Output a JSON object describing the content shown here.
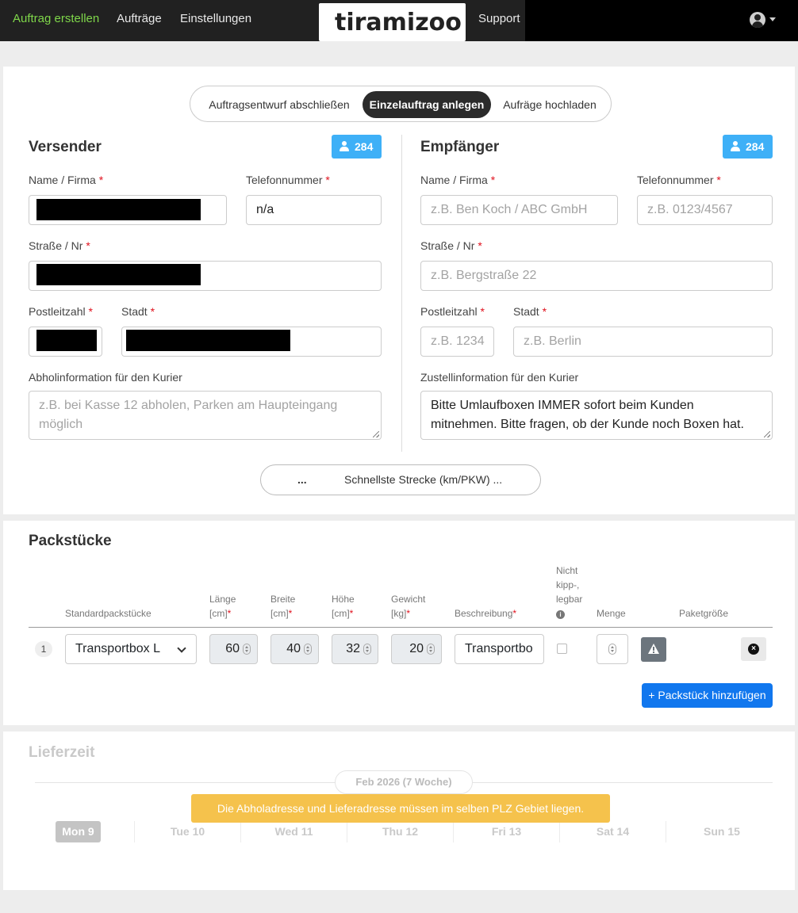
{
  "nav": {
    "create_order": "Auftrag erstellen",
    "orders": "Aufträge",
    "settings": "Einstellungen",
    "logo": "tiramizoo",
    "support": "Support",
    "accent_color": "#7fd74a"
  },
  "tabs": {
    "items": [
      "Auftragsentwurf abschließen",
      "Einzelauftrag anlegen",
      "Aufräge hochladen"
    ],
    "active": "Einzelauftrag anlegen"
  },
  "sender": {
    "title": "Versender",
    "badge_count": "284",
    "name_label": "Name / Firma",
    "phone_label": "Telefonnummer",
    "phone_value": "n/a",
    "street_label": "Straße / Nr",
    "zip_label": "Postleitzahl",
    "city_label": "Stadt",
    "info_label": "Abholinformation für den Kurier",
    "info_placeholder": "z.B. bei Kasse 12 abholen, Parken am Haupteingang möglich"
  },
  "recipient": {
    "title": "Empfänger",
    "badge_count": "284",
    "name_label": "Name / Firma",
    "name_placeholder": "z.B. Ben Koch / ABC GmbH",
    "phone_label": "Telefonnummer",
    "phone_placeholder": "z.B. 0123/4567",
    "street_label": "Straße / Nr",
    "street_placeholder": "z.B. Bergstraße 22",
    "zip_label": "Postleitzahl",
    "zip_placeholder": "z.B. 1234",
    "city_label": "Stadt",
    "city_placeholder": "z.B. Berlin",
    "info_label": "Zustellinformation für den Kurier",
    "info_value": "Bitte Umlaufboxen IMMER sofort beim Kunden mitnehmen. Bitte fragen, ob der Kunde noch Boxen hat."
  },
  "route": {
    "distance": "...",
    "label": "Schnellste Strecke (km/PKW) ..."
  },
  "packages": {
    "title": "Packstücke",
    "headers": {
      "standard": "Standardpackstücke",
      "length_1": "Länge",
      "length_2": "[cm]",
      "width_1": "Breite",
      "width_2": "[cm]",
      "height_1": "Höhe",
      "height_2": "[cm]",
      "weight_1": "Gewicht",
      "weight_2": "[kg]",
      "description": "Beschreibung",
      "tilt_1": "Nicht",
      "tilt_2": "kipp-,",
      "tilt_3": "legbar",
      "quantity": "Menge",
      "size": "Paketgröße"
    },
    "rows": [
      {
        "index": "1",
        "type": "Transportbox L",
        "length": "60",
        "width": "40",
        "height": "32",
        "weight": "20",
        "description": "Transportbo"
      }
    ],
    "add_label": "+ Packstück hinzufügen"
  },
  "delivery": {
    "title": "Lieferzeit",
    "week": "Feb 2026 (7 Woche)",
    "alert": "Die Abholadresse und Lieferadresse müssen im selben PLZ Gebiet liegen.",
    "days": [
      "Mon 9",
      "Tue 10",
      "Wed 11",
      "Thu 12",
      "Fri 13",
      "Sat 14",
      "Sun 15"
    ],
    "active_day": "Mon 9"
  }
}
